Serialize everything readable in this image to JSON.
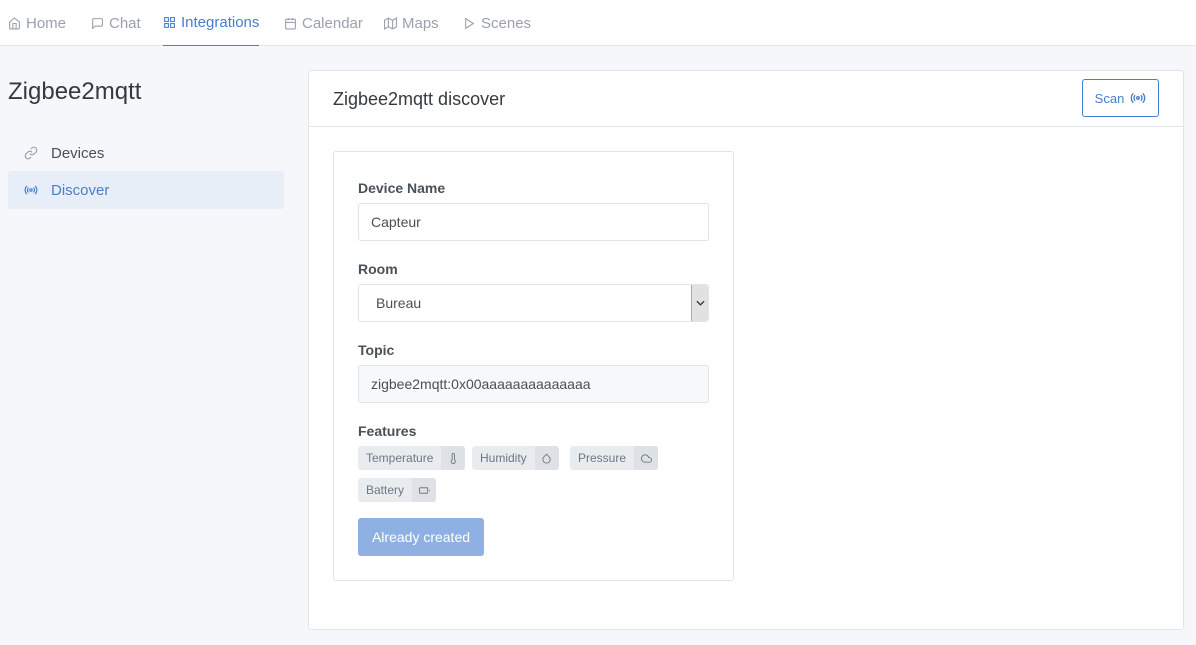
{
  "nav": {
    "items": [
      {
        "label": "Home",
        "icon": "home-icon"
      },
      {
        "label": "Chat",
        "icon": "chat-icon"
      },
      {
        "label": "Integrations",
        "icon": "grid-icon"
      },
      {
        "label": "Calendar",
        "icon": "calendar-icon"
      },
      {
        "label": "Maps",
        "icon": "map-icon"
      },
      {
        "label": "Scenes",
        "icon": "play-icon"
      }
    ],
    "active": "Integrations"
  },
  "sidebar": {
    "title": "Zigbee2mqtt",
    "items": [
      {
        "label": "Devices",
        "icon": "link-icon"
      },
      {
        "label": "Discover",
        "icon": "radio-icon"
      }
    ],
    "active": "Discover"
  },
  "card": {
    "title": "Zigbee2mqtt discover",
    "scan_label": "Scan"
  },
  "device": {
    "name_label": "Device Name",
    "name_value": "Capteur",
    "room_label": "Room",
    "room_value": "Bureau",
    "topic_label": "Topic",
    "topic_value": "zigbee2mqtt:0x00aaaaaaaaaaaaaa",
    "features_label": "Features",
    "features": [
      {
        "label": "Temperature",
        "icon": "thermometer-icon"
      },
      {
        "label": "Humidity",
        "icon": "droplet-icon"
      },
      {
        "label": "Pressure",
        "icon": "cloud-icon"
      },
      {
        "label": "Battery",
        "icon": "battery-icon"
      }
    ],
    "button_label": "Already created"
  },
  "colors": {
    "accent": "#467fcf",
    "disabled_button": "#8fb0e2",
    "background": "#f5f7fb"
  }
}
